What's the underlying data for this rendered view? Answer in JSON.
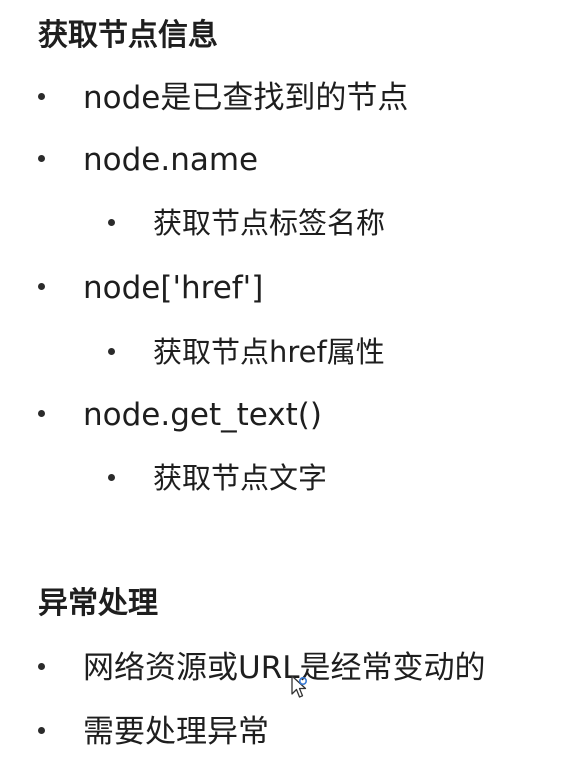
{
  "section1": {
    "heading": "获取节点信息",
    "items": [
      {
        "text": "node是已查找到的节点"
      },
      {
        "text": "node.name"
      },
      {
        "text": "获取节点标签名称"
      },
      {
        "text": "node['href']"
      },
      {
        "text": "获取节点href属性"
      },
      {
        "text": "node.get_text()"
      },
      {
        "text": "获取节点文字"
      }
    ]
  },
  "section2": {
    "heading": "异常处理",
    "items": [
      {
        "text": "网络资源或URL是经常变动的"
      },
      {
        "text": "需要处理异常"
      }
    ]
  },
  "icons": {
    "bullet": "bullet-dot",
    "cursor": "mouse-pointer-icon"
  },
  "colors": {
    "text": "#1e1e1e",
    "background": "#ffffff"
  }
}
